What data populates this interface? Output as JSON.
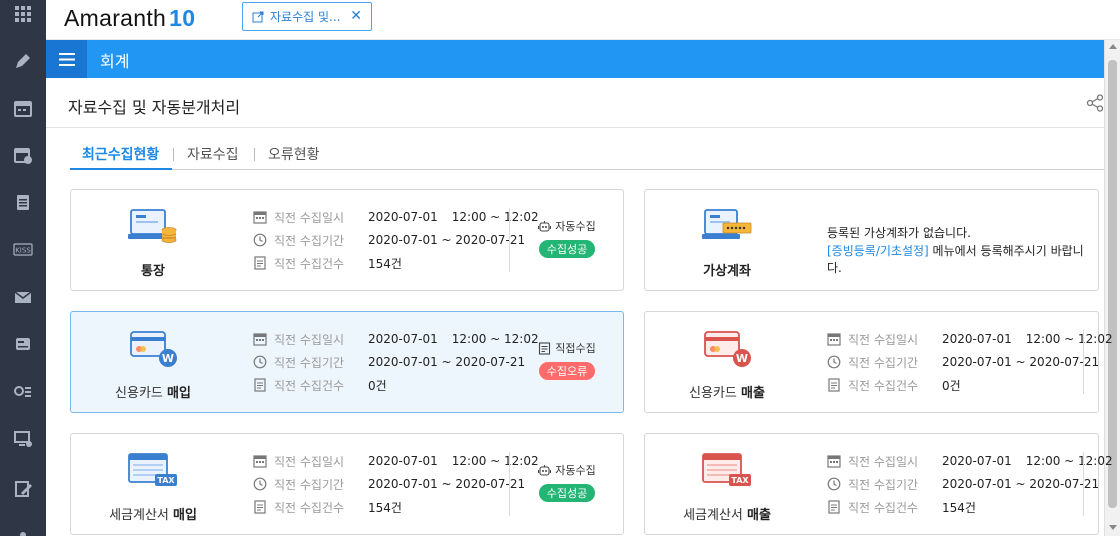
{
  "app": {
    "logo_name": "Amaranth",
    "logo_version": "10"
  },
  "open_tab": {
    "label": "자료수집 및..."
  },
  "module": {
    "title": "회계"
  },
  "page": {
    "title": "자료수집 및 자동분개처리"
  },
  "tabs": [
    {
      "label": "최근수집현황",
      "active": true
    },
    {
      "label": "자료수집",
      "active": false
    },
    {
      "label": "오류현황",
      "active": false
    }
  ],
  "labels": {
    "date": "직전 수집일시",
    "period": "직전 수집기간",
    "count": "직전 수집건수"
  },
  "cards": [
    {
      "name_prefix": "",
      "name_bold": "통장",
      "date": "2020-07-01",
      "time": "12:00 ~ 12:02",
      "period": "2020-07-01 ~ 2020-07-21",
      "count": "154건",
      "mode": "자동수집",
      "status": "수집성공"
    },
    {
      "name_prefix": "",
      "name_bold": "가상계좌",
      "msg1": "등록된 가상계좌가 없습니다.",
      "msg2_link": "[증빙등록/기초설정]",
      "msg2_rest": " 메뉴에서 등록해주시기 바랍니다."
    },
    {
      "name_prefix": "신용카드 ",
      "name_bold": "매입",
      "date": "2020-07-01",
      "time": "12:00 ~ 12:02",
      "period": "2020-07-01 ~ 2020-07-21",
      "count": "0건",
      "mode": "직접수집",
      "status": "수집오류"
    },
    {
      "name_prefix": "신용카드 ",
      "name_bold": "매출",
      "date": "2020-07-01",
      "time": "12:00 ~ 12:02",
      "period": "2020-07-01 ~ 2020-07-21",
      "count": "0건"
    },
    {
      "name_prefix": "세금계산서 ",
      "name_bold": "매입",
      "date": "2020-07-01",
      "time": "12:00 ~ 12:02",
      "period": "2020-07-01 ~ 2020-07-21",
      "count": "154건",
      "mode": "자동수집",
      "status": "수집성공"
    },
    {
      "name_prefix": "세금계산서 ",
      "name_bold": "매출",
      "date": "2020-07-01",
      "time": "12:00 ~ 12:02",
      "period": "2020-07-01 ~ 2020-07-21",
      "count": "154건"
    }
  ],
  "rail_icons": [
    "apps-grid-icon",
    "pen-icon",
    "calendar-icon",
    "calendar-clock-icon",
    "clipboard-icon",
    "kiss-icon",
    "mail-icon",
    "drive-icon",
    "list-settings-icon",
    "monitor-gear-icon",
    "edit-doc-icon",
    "more-icon"
  ],
  "colors": {
    "accent": "#2196f3",
    "success": "#22b573",
    "error": "#ff6b6b",
    "rail": "#2f3646"
  }
}
